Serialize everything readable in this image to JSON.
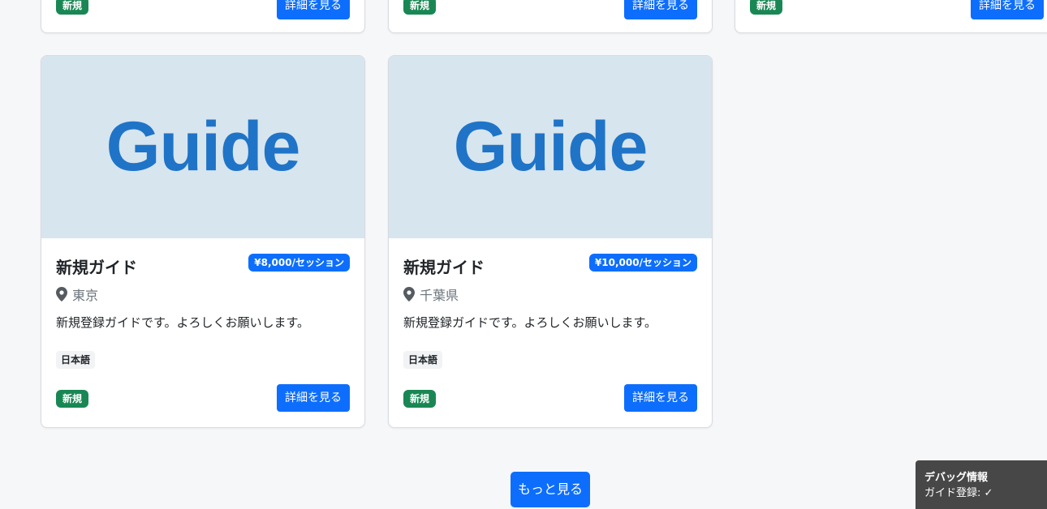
{
  "top_row": [
    {
      "badge": "新規",
      "button": "詳細を見る"
    },
    {
      "badge": "新規",
      "button": "詳細を見る"
    },
    {
      "badge": "新規",
      "button": "詳細を見る"
    }
  ],
  "cards": [
    {
      "image_text": "Guide",
      "title": "新規ガイド",
      "price": "¥8,000/セッション",
      "location": "東京",
      "description": "新規登録ガイドです。よろしくお願いします。",
      "language": "日本語",
      "badge": "新規",
      "button": "詳細を見る"
    },
    {
      "image_text": "Guide",
      "title": "新規ガイド",
      "price": "¥10,000/セッション",
      "location": "千葉県",
      "description": "新規登録ガイドです。よろしくお願いします。",
      "language": "日本語",
      "badge": "新規",
      "button": "詳細を見る"
    }
  ],
  "more_button": "もっと見る",
  "debug": {
    "title": "デバッグ情報",
    "line": "ガイド登録: ✓"
  },
  "colors": {
    "primary": "#0d6efd",
    "success": "#198754",
    "image_bg": "#d7e5ef",
    "image_text": "#1f74c7"
  },
  "icons": [
    "map-pin-icon"
  ]
}
